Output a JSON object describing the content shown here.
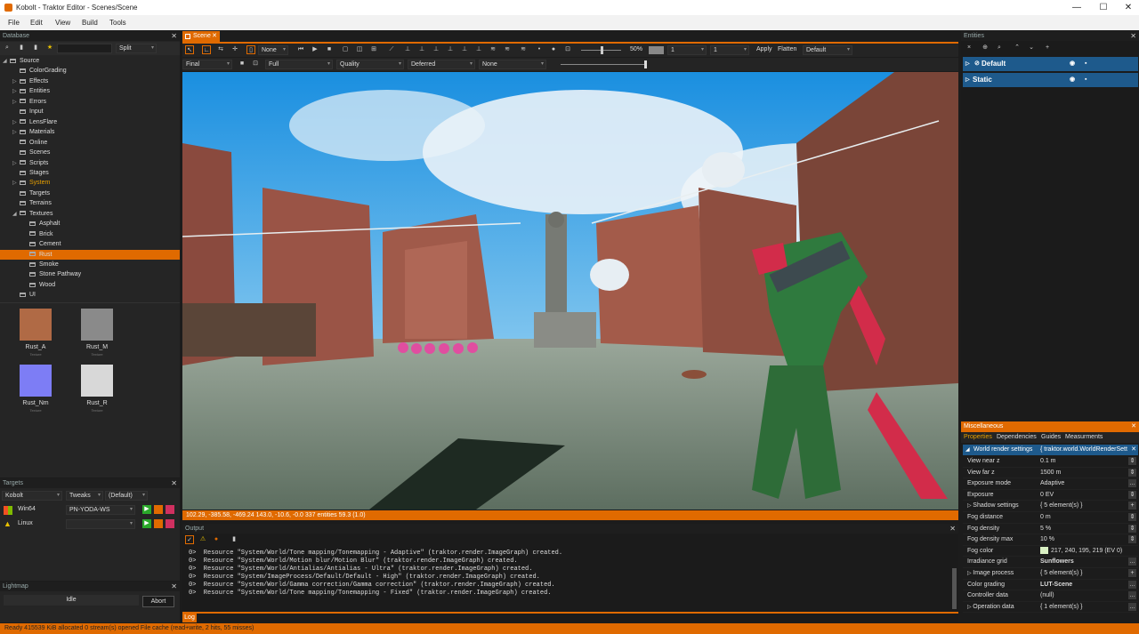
{
  "window": {
    "title": "Kobolt - Traktor Editor - Scenes/Scene",
    "minimize": "—",
    "maximize": "☐",
    "close": "✕"
  },
  "menu": [
    "File",
    "Edit",
    "View",
    "Build",
    "Tools"
  ],
  "database": {
    "header": "Database",
    "split_label": "Split",
    "tree": [
      {
        "label": "Source",
        "level": 0,
        "expanded": true
      },
      {
        "label": "ColorGrading",
        "level": 1
      },
      {
        "label": "Effects",
        "level": 1,
        "arrow": true
      },
      {
        "label": "Entities",
        "level": 1,
        "arrow": true
      },
      {
        "label": "Errors",
        "level": 1,
        "arrow": true
      },
      {
        "label": "Input",
        "level": 1
      },
      {
        "label": "LensFlare",
        "level": 1,
        "arrow": true
      },
      {
        "label": "Materials",
        "level": 1,
        "arrow": true
      },
      {
        "label": "Online",
        "level": 1
      },
      {
        "label": "Scenes",
        "level": 1
      },
      {
        "label": "Scripts",
        "level": 1,
        "arrow": true
      },
      {
        "label": "Stages",
        "level": 1
      },
      {
        "label": "System",
        "level": 1,
        "arrow": true,
        "highlight": true
      },
      {
        "label": "Targets",
        "level": 1
      },
      {
        "label": "Terrains",
        "level": 1
      },
      {
        "label": "Textures",
        "level": 1,
        "expanded": true
      },
      {
        "label": "Asphalt",
        "level": 2
      },
      {
        "label": "Brick",
        "level": 2
      },
      {
        "label": "Cement",
        "level": 2
      },
      {
        "label": "Rust",
        "level": 2,
        "selected": true
      },
      {
        "label": "Smoke",
        "level": 2
      },
      {
        "label": "Stone Pathway",
        "level": 2
      },
      {
        "label": "Wood",
        "level": 2
      },
      {
        "label": "UI",
        "level": 1
      }
    ],
    "thumbnails": [
      {
        "name": "Rust_A",
        "sub": "Texture",
        "color": "#b06a45"
      },
      {
        "name": "Rust_M",
        "sub": "Texture",
        "color": "#8a8a8a"
      },
      {
        "name": "Rust_Nm",
        "sub": "Texture",
        "color": "#7d7df5"
      },
      {
        "name": "Rust_R",
        "sub": "Texture",
        "color": "#d8d8d8"
      }
    ]
  },
  "targets": {
    "header": "Targets",
    "config": "Kobolt",
    "tweaks": "Tweaks",
    "default": "(Default)",
    "rows": [
      {
        "name": "Win64",
        "host": "PN-YODA-WS"
      },
      {
        "name": "Linux",
        "host": ""
      }
    ]
  },
  "lightmap": {
    "header": "Lightmap",
    "status": "Idle",
    "abort": "Abort"
  },
  "scene": {
    "tab": "Scene",
    "toolbar": {
      "none": "None",
      "zoom": "50%",
      "v1": "1",
      "v2": "1",
      "apply": "Apply",
      "flatten": "Flatten",
      "default": "Default"
    },
    "toolbar2": {
      "final": "Final",
      "full": "Full",
      "quality": "Quality",
      "deferred": "Deferred",
      "none": "None"
    },
    "status": "102.29, -385.58, -469.24  143.0, -10.6, -0.0  337 entities  59.3 (1.0)"
  },
  "output": {
    "header": "Output",
    "lines": [
      "0>  Resource \"System/World/Tone mapping/Tonemapping - Adaptive\" (traktor.render.ImageGraph) created.",
      "0>  Resource \"System/World/Motion blur/Motion Blur\" (traktor.render.ImageGraph) created.",
      "0>  Resource \"System/World/Antialias/Antialias - Ultra\" (traktor.render.ImageGraph) created.",
      "0>  Resource \"System/ImageProcess/Default/Default - High\" (traktor.render.ImageGraph) created.",
      "0>  Resource \"System/World/Gamma correction/Gamma correction\" (traktor.render.ImageGraph) created.",
      "0>  Resource \"System/World/Tone mapping/Tonemapping - Fixed\" (traktor.render.ImageGraph) created."
    ],
    "log_tab": "Log"
  },
  "entities": {
    "header": "Entities",
    "rows": [
      {
        "name": "Default"
      },
      {
        "name": "Static"
      }
    ]
  },
  "misc": {
    "header": "Miscellaneous",
    "tabs": [
      "Properties",
      "Dependencies",
      "Guides",
      "Measurments"
    ],
    "root": {
      "name": "World render settings",
      "value": "{ traktor.world.WorldRenderSetti"
    },
    "props": [
      {
        "name": "View near z",
        "value": "0.1 m",
        "btn": "⇕"
      },
      {
        "name": "View far z",
        "value": "1500 m",
        "btn": "⇕"
      },
      {
        "name": "Exposure mode",
        "value": "Adaptive",
        "btn": "…"
      },
      {
        "name": "Exposure",
        "value": "0 EV",
        "btn": "⇕"
      },
      {
        "name": "Shadow settings",
        "value": "{ 5 element(s) }",
        "btn": "+",
        "arrow": true
      },
      {
        "name": "Fog distance",
        "value": "0 m",
        "btn": "⇕"
      },
      {
        "name": "Fog density",
        "value": "5 %",
        "btn": "⇕"
      },
      {
        "name": "Fog density max",
        "value": "10 %",
        "btn": "⇕"
      },
      {
        "name": "Fog color",
        "value": "217, 240, 195, 219 (EV 0)",
        "btn": "",
        "swatch": "#d9f0c3"
      },
      {
        "name": "Irradiance grid",
        "value": "Sunflowers",
        "btn": "…",
        "bold": true
      },
      {
        "name": "Image process",
        "value": "{ 5 element(s) }",
        "btn": "+",
        "arrow": true
      },
      {
        "name": "Color grading",
        "value": "LUT-Scene",
        "btn": "…",
        "bold": true
      },
      {
        "name": "Controller data",
        "value": "(null)",
        "btn": "…"
      },
      {
        "name": "Operation data",
        "value": "{ 1 element(s) }",
        "btn": "…",
        "arrow": true
      }
    ]
  },
  "statusbar": "Ready  415539 KiB allocated  0 stream(s) opened  File cache (read+write, 2 hits, 55 misses)"
}
